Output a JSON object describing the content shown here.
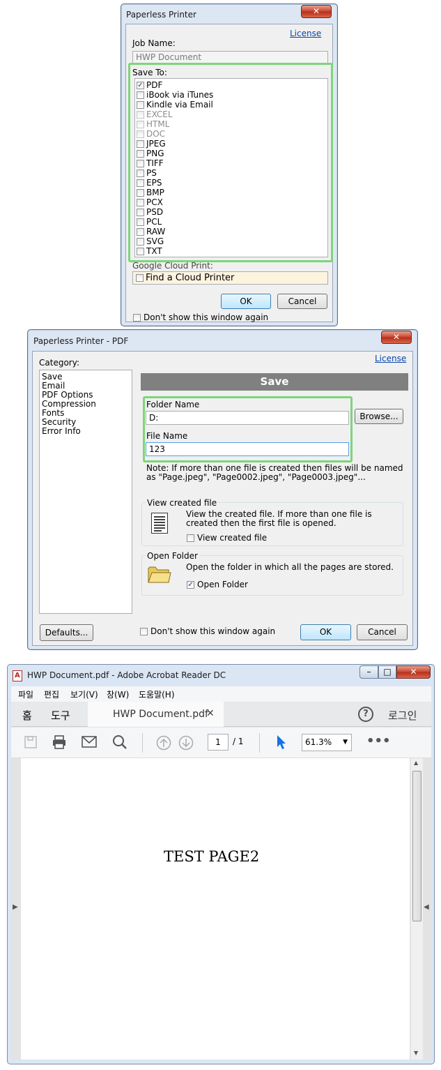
{
  "dialog1": {
    "title": "Paperless Printer",
    "license": "License",
    "job_name_label": "Job Name:",
    "job_name_value": "HWP Document",
    "save_to_label": "Save To:",
    "formats": [
      {
        "label": "PDF",
        "checked": true,
        "enabled": true
      },
      {
        "label": "iBook via iTunes",
        "checked": false,
        "enabled": true
      },
      {
        "label": "Kindle via Email",
        "checked": false,
        "enabled": true
      },
      {
        "label": "EXCEL",
        "checked": false,
        "enabled": false
      },
      {
        "label": "HTML",
        "checked": false,
        "enabled": false
      },
      {
        "label": "DOC",
        "checked": false,
        "enabled": false
      },
      {
        "label": "JPEG",
        "checked": false,
        "enabled": true
      },
      {
        "label": "PNG",
        "checked": false,
        "enabled": true
      },
      {
        "label": "TIFF",
        "checked": false,
        "enabled": true
      },
      {
        "label": "PS",
        "checked": false,
        "enabled": true
      },
      {
        "label": "EPS",
        "checked": false,
        "enabled": true
      },
      {
        "label": "BMP",
        "checked": false,
        "enabled": true
      },
      {
        "label": "PCX",
        "checked": false,
        "enabled": true
      },
      {
        "label": "PSD",
        "checked": false,
        "enabled": true
      },
      {
        "label": "PCL",
        "checked": false,
        "enabled": true
      },
      {
        "label": "RAW",
        "checked": false,
        "enabled": true
      },
      {
        "label": "SVG",
        "checked": false,
        "enabled": true
      },
      {
        "label": "TXT",
        "checked": false,
        "enabled": true
      }
    ],
    "google_cloud_label": "Google Cloud Print:",
    "cloud_printer": "Find a Cloud Printer",
    "ok": "OK",
    "cancel": "Cancel",
    "dont_show": "Don't show this window again"
  },
  "dialog2": {
    "title": "Paperless Printer - PDF",
    "license": "License",
    "category_label": "Category:",
    "categories": [
      "Save",
      "Email",
      "PDF Options",
      "Compression",
      "Fonts",
      "Security",
      "Error Info"
    ],
    "section_title": "Save",
    "folder_name_label": "Folder Name",
    "folder_name_value": "D:",
    "browse": "Browse...",
    "file_name_label": "File Name",
    "file_name_value": "123",
    "note_line1": "Note: If more than one file is created then files will be named",
    "note_line2": "as \"Page.jpeg\", \"Page0002.jpeg\", \"Page0003.jpeg\"...",
    "view_group_title": "View created file",
    "view_desc_line1": "View the created file. If more than one file is",
    "view_desc_line2": "created then the first file is opened.",
    "view_checkbox": "View created file",
    "open_group_title": "Open Folder",
    "open_desc": "Open the folder in which all the pages are stored.",
    "open_checkbox": "Open Folder",
    "defaults": "Defaults...",
    "dont_show": "Don't show this window again",
    "ok": "OK",
    "cancel": "Cancel"
  },
  "acrobat": {
    "title": "HWP Document.pdf - Adobe Acrobat Reader DC",
    "menu": [
      "파일",
      "편집",
      "보기(V)",
      "창(W)",
      "도움말(H)"
    ],
    "tab_home": "홈",
    "tab_tools": "도구",
    "doc_tab": "HWP Document.pdf",
    "login": "로그인",
    "page_current": "1",
    "page_total": "/ 1",
    "zoom": "61.3%",
    "page_text": "TEST PAGE2"
  }
}
